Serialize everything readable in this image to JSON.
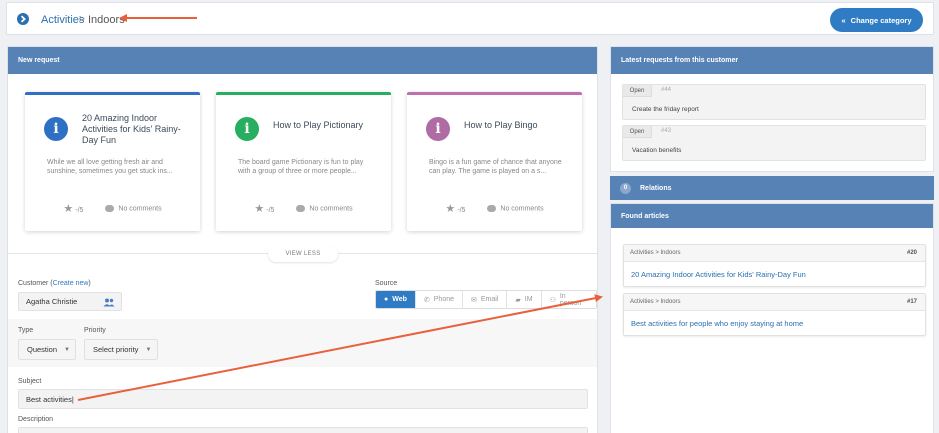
{
  "header": {
    "breadcrumb_link": "Activities",
    "breadcrumb_sep": ">",
    "breadcrumb_current": "Indoors",
    "change_category_label": "Change category"
  },
  "new_request": {
    "title": "New request",
    "cards": [
      {
        "title": "20 Amazing Indoor Activities for Kids' Rainy-Day Fun",
        "text": "While we all love getting fresh air and sunshine, sometimes you get stuck ins...",
        "rating": "-/5",
        "comments": "No comments",
        "accent": "#2f6fc4",
        "icon_color": "#2f6fc4"
      },
      {
        "title": "How to Play Pictionary",
        "text": "The board game Pictionary is fun to play with a group of three or more people...",
        "rating": "-/5",
        "comments": "No comments",
        "accent": "#27ae60",
        "icon_color": "#27ae60"
      },
      {
        "title": "How to Play Bingo",
        "text": "Bingo is a fun game of chance that anyone can play. The game is played on a s...",
        "rating": "-/5",
        "comments": "No comments",
        "accent": "#c06fb0",
        "icon_color": "#b06aa4"
      }
    ],
    "view_less_label": "VIEW LESS",
    "customer_label": "Customer",
    "create_new_label": "Create new",
    "customer_value": "Agatha Christie",
    "source_label": "Source",
    "source_options": [
      "Web",
      "Phone",
      "Email",
      "IM",
      "In person"
    ],
    "source_selected": "Web",
    "type_label": "Type",
    "type_value": "Question",
    "priority_label": "Priority",
    "priority_value": "Select priority",
    "subject_label": "Subject",
    "subject_value": "Best activities",
    "description_label": "Description"
  },
  "sidebar": {
    "latest_title": "Latest requests from this customer",
    "tickets": [
      {
        "status": "Open",
        "number": "#44",
        "name": "Create the friday report"
      },
      {
        "status": "Open",
        "number": "#43",
        "name": "Vacation benefits"
      }
    ],
    "relations_count": "0",
    "relations_label": "Relations",
    "found_articles_label": "Found articles",
    "articles": [
      {
        "path": "Activities > Indoors",
        "number": "#20",
        "title": "20 Amazing Indoor Activities for Kids' Rainy-Day Fun"
      },
      {
        "path": "Activities > Indoors",
        "number": "#17",
        "title": "Best activities for people who enjoy staying at home"
      }
    ]
  },
  "colors": {
    "accent_blue": "#2f7bc4",
    "panel_header": "#5682b6",
    "annotation_arrow": "#e8603c"
  }
}
